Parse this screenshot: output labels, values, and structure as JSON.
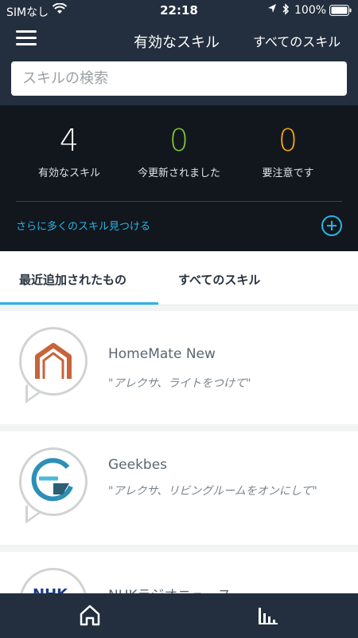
{
  "status": {
    "carrier": "SIMなし",
    "time": "22:18",
    "battery": "100%"
  },
  "nav": {
    "title": "有効なスキル",
    "all_skills": "すべてのスキル"
  },
  "search": {
    "placeholder": "スキルの検索"
  },
  "stats": {
    "enabled": {
      "value": "4",
      "label": "有効なスキル",
      "color": "#ffffff"
    },
    "updated": {
      "value": "0",
      "label": "今更新されました",
      "color": "#7cbf3a"
    },
    "attention": {
      "value": "0",
      "label": "要注意です",
      "color": "#f0a30a"
    }
  },
  "discover": {
    "label": "さらに多くのスキル見つける",
    "icon": "add-circle-icon"
  },
  "tabs": {
    "recent": "最近追加されたもの",
    "all": "すべてのスキル"
  },
  "skills": [
    {
      "name": "HomeMate New",
      "phrase": "\"アレクサ、ライトをつけて\"",
      "icon": "house-logo-icon"
    },
    {
      "name": "Geekbes",
      "phrase": "\"アレクサ、リビングルームをオンにして\"",
      "icon": "geekbes-logo-icon"
    },
    {
      "name": "NHKラジオニュース",
      "phrase": "",
      "icon": "nhk-logo-icon"
    }
  ],
  "colors": {
    "header_bg": "#232f3e",
    "stats_bg": "#12171d",
    "accent": "#2ab3e6"
  }
}
